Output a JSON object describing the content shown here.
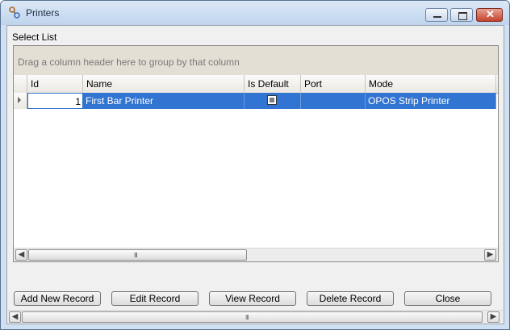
{
  "window": {
    "title": "Printers"
  },
  "form": {
    "section_label": "Select List"
  },
  "grid": {
    "group_panel_text": "Drag a column header here to group by that column",
    "columns": [
      "Id",
      "Name",
      "Is Default",
      "Port",
      "Mode"
    ],
    "rows": [
      {
        "id": "1",
        "name": "First Bar Printer",
        "is_default": false,
        "port": "",
        "mode": "OPOS Strip Printer"
      }
    ]
  },
  "buttons": {
    "add": "Add New Record",
    "edit": "Edit Record",
    "view": "View Record",
    "delete": "Delete Record",
    "close": "Close"
  },
  "icons": {
    "scroll_left": "◀",
    "scroll_right": "▶",
    "grip": "III",
    "close_glyph": "✕"
  },
  "colors": {
    "selection": "#3274d2",
    "title_text": "#1b2b44"
  }
}
